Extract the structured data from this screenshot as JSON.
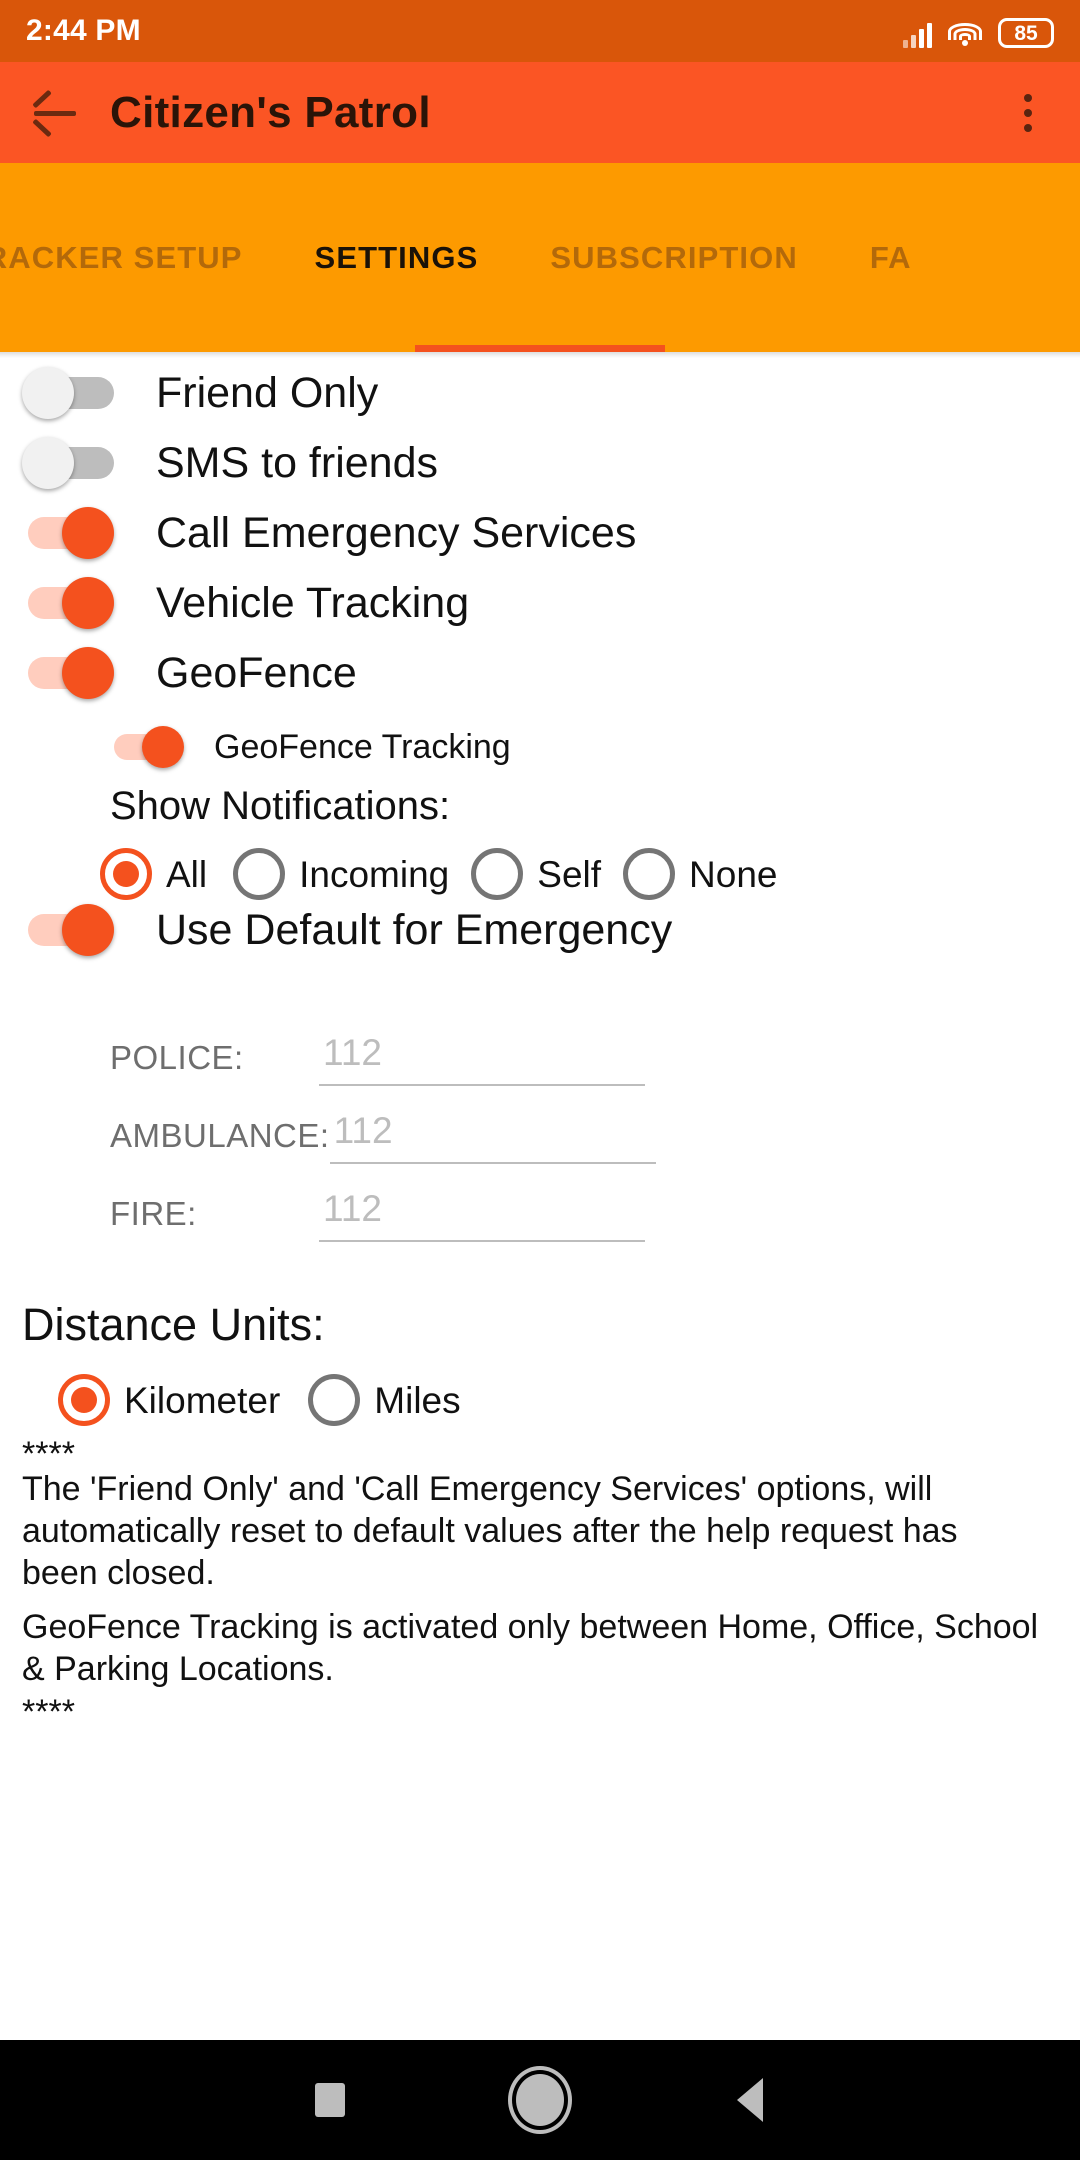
{
  "status_bar": {
    "clock": "2:44 PM",
    "battery_level": "85",
    "signal_icon": "cellular-signal-icon",
    "wifi_icon": "wifi-icon",
    "battery_icon": "battery-icon"
  },
  "app_bar": {
    "title": "Citizen's Patrol",
    "back_icon": "back-arrow-icon",
    "overflow_icon": "overflow-menu-icon",
    "background_color": "#FB5524"
  },
  "tabs": {
    "items": [
      {
        "label": "ICLE TRACKER SETUP",
        "active": false
      },
      {
        "label": "SETTINGS",
        "active": true
      },
      {
        "label": "SUBSCRIPTION",
        "active": false
      },
      {
        "label": "FA",
        "active": false
      }
    ],
    "indicator_color": "#F4511E",
    "background_color": "#FD9A00"
  },
  "settings": {
    "toggles": [
      {
        "label": "Friend Only",
        "state": "off"
      },
      {
        "label": "SMS to friends",
        "state": "off"
      },
      {
        "label": "Call Emergency Services",
        "state": "on"
      },
      {
        "label": "Vehicle Tracking",
        "state": "on"
      },
      {
        "label": "GeoFence",
        "state": "on"
      }
    ],
    "geofence_tracking": {
      "label": "GeoFence Tracking",
      "state": "on"
    },
    "notifications": {
      "title": "Show Notifications:",
      "options": [
        {
          "label": "All",
          "selected": true
        },
        {
          "label": "Incoming",
          "selected": false
        },
        {
          "label": "Self",
          "selected": false
        },
        {
          "label": "None",
          "selected": false
        }
      ]
    },
    "use_default_emergency": {
      "label": "Use Default for Emergency",
      "state": "on"
    },
    "emergency_numbers": [
      {
        "label": "POLICE:",
        "value": "",
        "placeholder": "112"
      },
      {
        "label": "AMBULANCE:",
        "value": "",
        "placeholder": "112"
      },
      {
        "label": "FIRE:",
        "value": "",
        "placeholder": "112"
      }
    ],
    "distance_units": {
      "title": "Distance Units:",
      "options": [
        {
          "label": "Kilometer",
          "selected": true
        },
        {
          "label": "Miles",
          "selected": false
        }
      ]
    },
    "notes": {
      "top_separator": "****",
      "paragraph_1": "The 'Friend Only' and 'Call Emergency Services' options, will automatically reset to default values after the help request has been closed.",
      "paragraph_2": "GeoFence Tracking is activated only between Home, Office, School & Parking Locations.",
      "bottom_separator": "****"
    }
  },
  "nav_bar": {
    "recent_icon": "recent-apps-square-icon",
    "home_icon": "home-circle-icon",
    "back_icon": "back-triangle-icon"
  }
}
